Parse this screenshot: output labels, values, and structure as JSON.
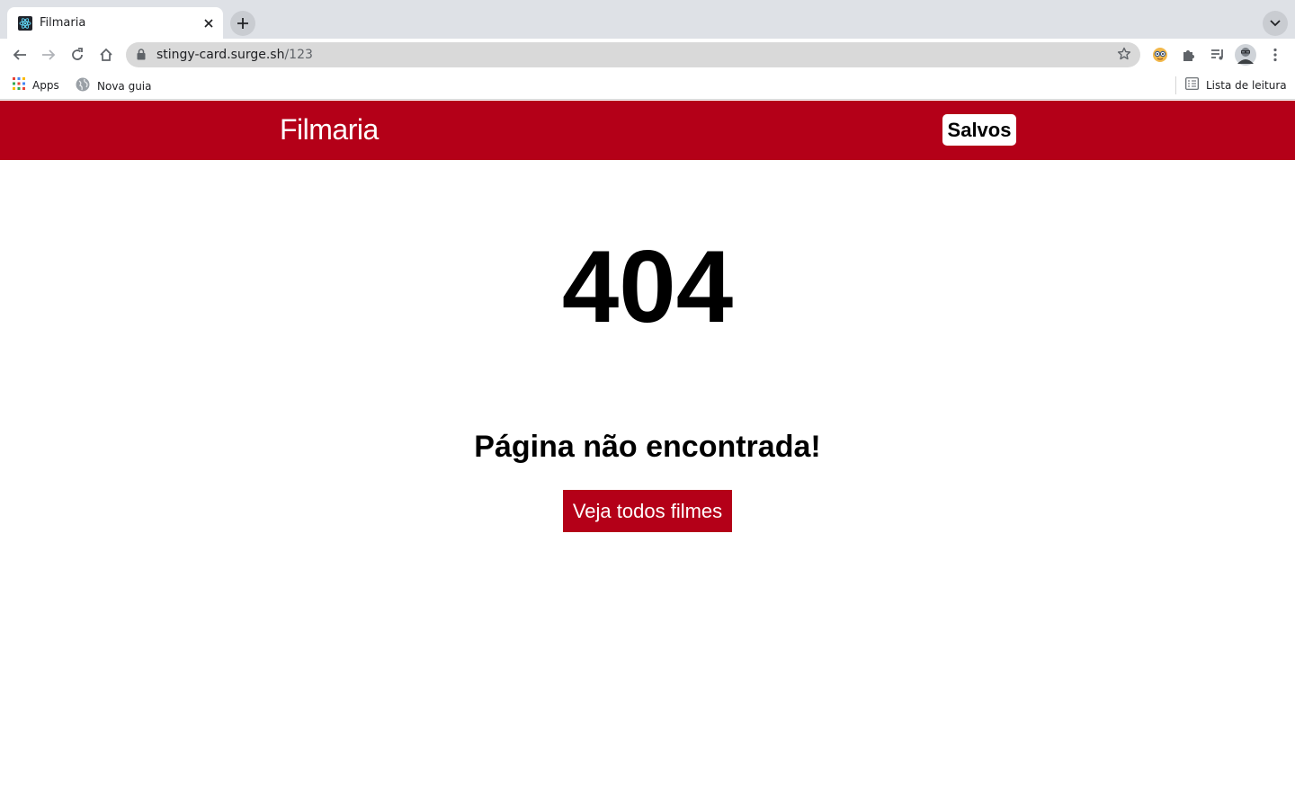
{
  "browser": {
    "tab": {
      "title": "Filmaria",
      "favicon": "react-icon"
    },
    "address": {
      "host": "stingy-card.surge.sh",
      "path": "/123"
    },
    "bookmarks": [
      {
        "label": "Apps",
        "icon": "apps-grid-icon"
      },
      {
        "label": "Nova guia",
        "icon": "globe-icon"
      }
    ],
    "reading_list": "Lista de leitura"
  },
  "site": {
    "logo": "Filmaria",
    "saved_label": "Salvos",
    "brand_color": "#b40018"
  },
  "error": {
    "code": "404",
    "message": "Página não encontrada!",
    "action_label": "Veja todos filmes"
  }
}
